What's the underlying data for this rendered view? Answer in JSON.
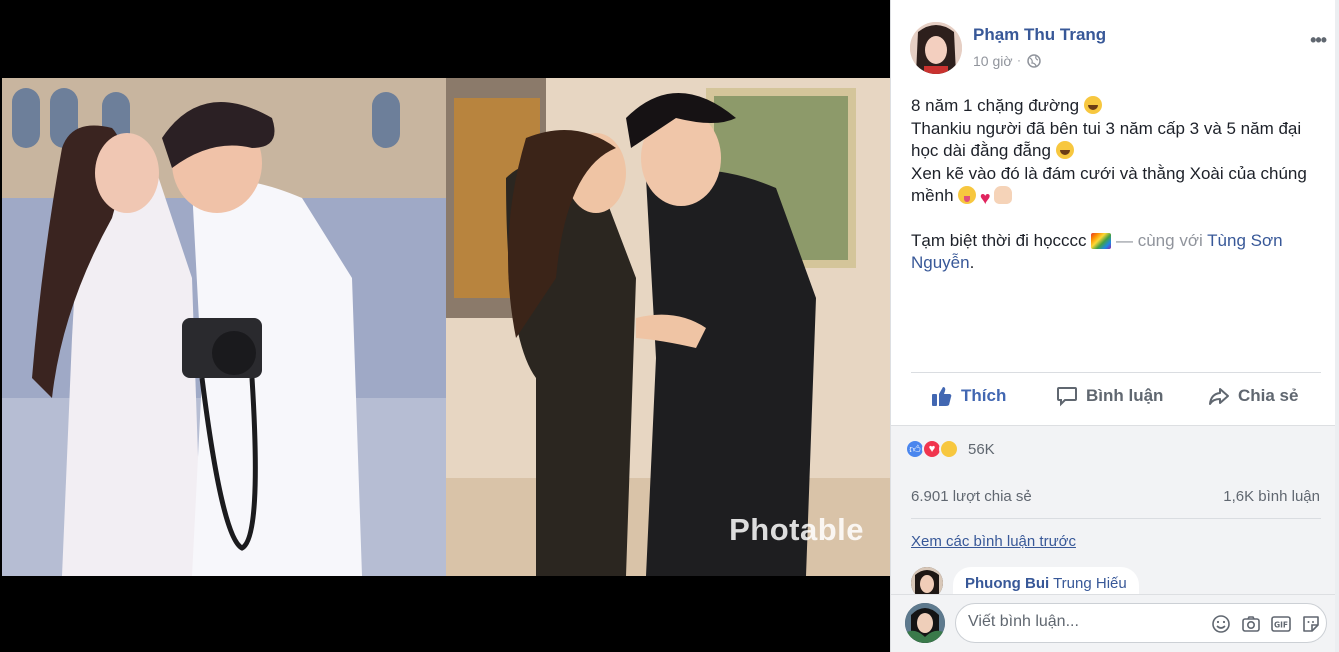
{
  "photo": {
    "watermark": "Photable"
  },
  "post": {
    "author": "Phạm Thu Trang",
    "time": "10 giờ",
    "dot": "·",
    "more_icon": "more-horizontal-icon",
    "privacy_icon": "globe-icon",
    "lines": {
      "line1": "8 năm 1 chặng đường ",
      "line2": "Thankiu người đã bên tui 3 năm cấp 3 và 5 năm đại học dài đằng đẵng ",
      "line3": "Xen kẽ vào đó là đám cưới và thằng Xoài của chúng mềnh ",
      "line4_a": "Tạm biệt thời đi họcccc ",
      "line4_b": " — cùng với ",
      "tagged": "Tùng Sơn Nguyễn",
      "line4_end": "."
    }
  },
  "actions": {
    "like": "Thích",
    "comment": "Bình luận",
    "share": "Chia sẻ"
  },
  "stats": {
    "reactions": "56K",
    "shares": "6.901 lượt chia sẻ",
    "comments": "1,6K bình luận"
  },
  "comments": {
    "view_previous": "Xem các bình luận trước",
    "preview_name": "Phuong Bui",
    "preview_tag": "Trung Hiếu"
  },
  "composer": {
    "placeholder": "Viết bình luận..."
  },
  "colors": {
    "link": "#385898",
    "like_blue": "#4267b2",
    "muted": "#90949c",
    "panel_bg": "#f2f3f5"
  }
}
